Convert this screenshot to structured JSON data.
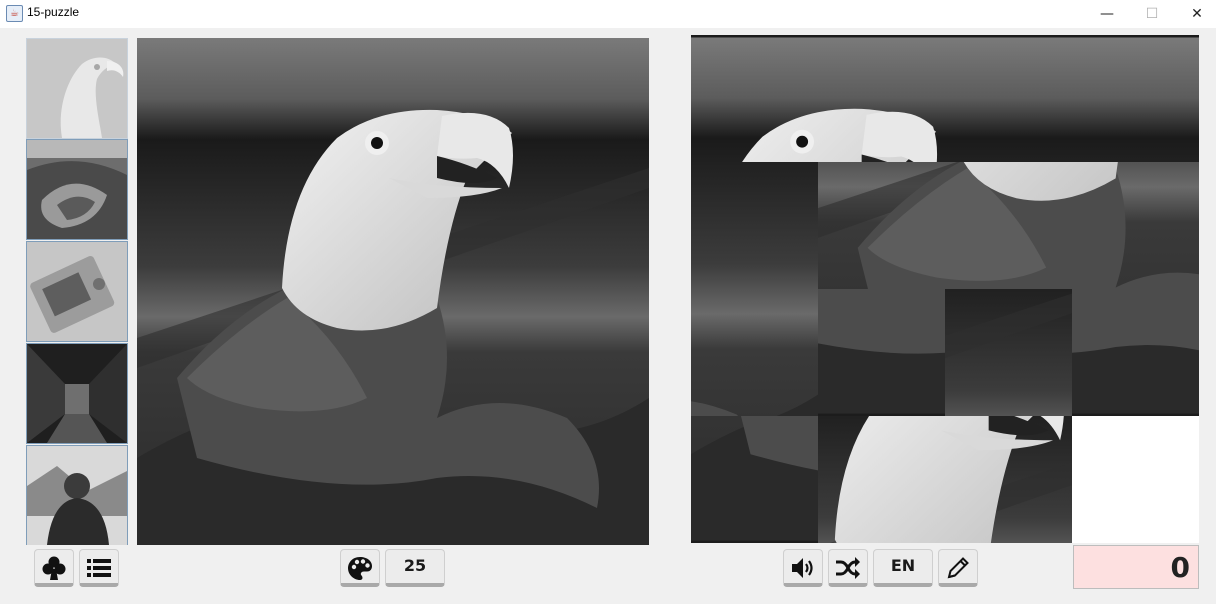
{
  "window": {
    "title": "15-puzzle",
    "minimize_glyph": "—",
    "maximize_glyph": "☐",
    "close_glyph": "✕"
  },
  "thumbnails": [
    {
      "subject": "eagle",
      "selected": true
    },
    {
      "subject": "canyon",
      "selected": false
    },
    {
      "subject": "laptop-on-desk",
      "selected": false
    },
    {
      "subject": "city-alley",
      "selected": false
    },
    {
      "subject": "hooded-person",
      "selected": false
    }
  ],
  "toolbar_left": {
    "clover_icon": "club-icon",
    "list_icon": "list-icon"
  },
  "toolbar_center": {
    "palette_icon": "palette-icon",
    "size_label": "25"
  },
  "toolbar_right": {
    "sound_icon": "speaker-icon",
    "shuffle_icon": "shuffle-icon",
    "language_label": "EN",
    "edit_icon": "pencil-icon"
  },
  "moves_counter": "0",
  "board": {
    "grid": 4,
    "tile_order": [
      2,
      3,
      4,
      1,
      5,
      9,
      10,
      11,
      12,
      14,
      8,
      15,
      13,
      6,
      7,
      0
    ],
    "empty_tile_color": "#ffffff"
  },
  "colors": {
    "counter_background": "#fde0e0",
    "button_face": "#ececec",
    "window_background": "#f0f0f0"
  }
}
